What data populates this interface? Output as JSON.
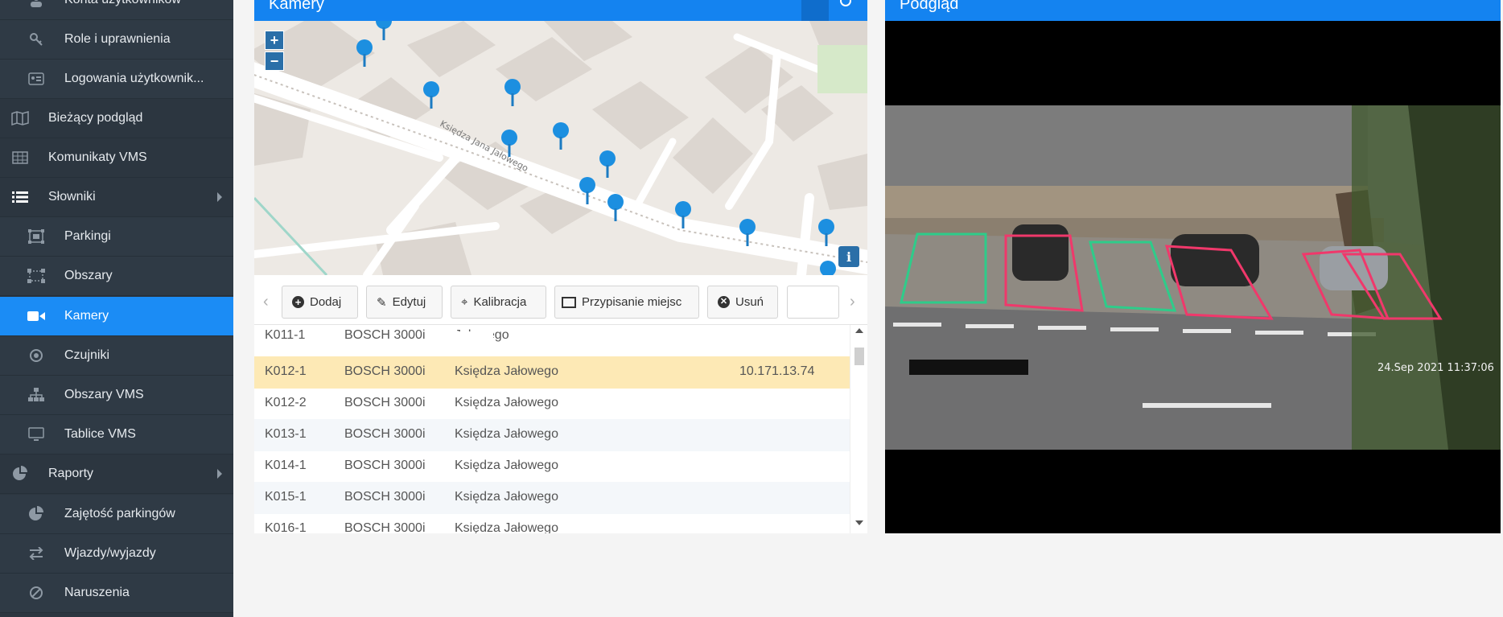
{
  "sidebar": {
    "items": [
      {
        "label": "Konta użytkowników",
        "icon": "user-icon",
        "sub": true
      },
      {
        "label": "Role i uprawnienia",
        "icon": "key-icon",
        "sub": true
      },
      {
        "label": "Logowania użytkownik...",
        "icon": "id-card-icon",
        "sub": true
      },
      {
        "label": "Bieżący podgląd",
        "icon": "map-icon",
        "sub": false
      },
      {
        "label": "Komunikaty VMS",
        "icon": "table-icon",
        "sub": false
      },
      {
        "label": "Słowniki",
        "icon": "list-icon",
        "sub": false,
        "expandable": true
      },
      {
        "label": "Parkingi",
        "icon": "parking-icon",
        "sub": true
      },
      {
        "label": "Obszary",
        "icon": "area-icon",
        "sub": true
      },
      {
        "label": "Kamery",
        "icon": "video-camera-icon",
        "sub": true,
        "active": true
      },
      {
        "label": "Czujniki",
        "icon": "sensor-icon",
        "sub": true
      },
      {
        "label": "Obszary VMS",
        "icon": "sitemap-icon",
        "sub": true
      },
      {
        "label": "Tablice VMS",
        "icon": "monitor-icon",
        "sub": true
      },
      {
        "label": "Raporty",
        "icon": "pie-chart-icon",
        "sub": false,
        "expandable": true
      },
      {
        "label": "Zajętość parkingów",
        "icon": "pie-chart-icon",
        "sub": true
      },
      {
        "label": "Wjazdy/wyjazdy",
        "icon": "exchange-icon",
        "sub": true
      },
      {
        "label": "Naruszenia",
        "icon": "ban-icon",
        "sub": true
      }
    ]
  },
  "cameras_panel": {
    "title": "Kamery"
  },
  "preview_panel": {
    "title": "Podgląd"
  },
  "map": {
    "zoom_in": "+",
    "zoom_out": "−",
    "info": "i",
    "street_label": "Księdza Jana Jałowego"
  },
  "toolbar": {
    "add": "Dodaj",
    "edit": "Edytuj",
    "calibrate": "Kalibracja",
    "assign": "Przypisanie miejsc",
    "delete": "Usuń"
  },
  "table": {
    "rows": [
      [
        "K011-1",
        "BOSCH 3000i",
        "Jałowego",
        ""
      ],
      [
        "K012-1",
        "BOSCH 3000i",
        "Księdza Jałowego",
        "10.171.13.74"
      ],
      [
        "K012-2",
        "BOSCH 3000i",
        "Księdza Jałowego",
        ""
      ],
      [
        "K013-1",
        "BOSCH 3000i",
        "Księdza Jałowego",
        ""
      ],
      [
        "K014-1",
        "BOSCH 3000i",
        "Księdza Jałowego",
        ""
      ],
      [
        "K015-1",
        "BOSCH 3000i",
        "Księdza Jałowego",
        ""
      ],
      [
        "K016-1",
        "BOSCH 3000i",
        "Księdza Jałowego",
        ""
      ]
    ],
    "selected_index": 1
  },
  "camera_feed": {
    "timestamp": "24.Sep 2021   11:37:06"
  },
  "colors": {
    "sidebar_bg": "#2c3640",
    "accent": "#1b8cf5",
    "selected_row": "#fde9b5",
    "free_spot": "#2ecc8a",
    "occupied_spot": "#f0386b"
  }
}
